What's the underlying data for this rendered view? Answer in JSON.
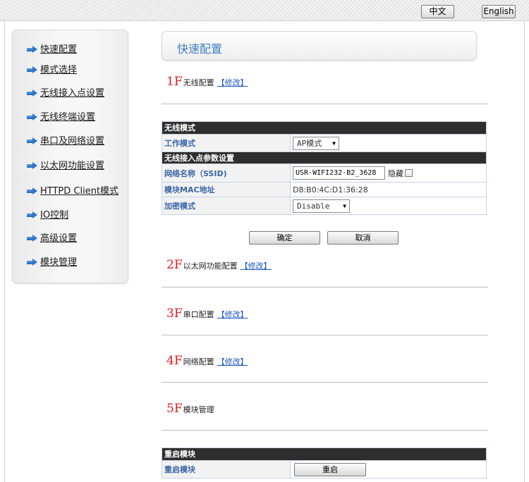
{
  "language": {
    "chinese": "中文",
    "english": "English"
  },
  "sidebar": {
    "items": [
      {
        "label": "快速配置"
      },
      {
        "label": "模式选择"
      },
      {
        "label": "无线接入点设置"
      },
      {
        "label": "无线终端设置"
      },
      {
        "label": "串口及网络设置"
      },
      {
        "label": "以太网功能设置"
      },
      {
        "label": "HTTPD Client模式"
      },
      {
        "label": "IO控制"
      },
      {
        "label": "高级设置"
      },
      {
        "label": "模块管理"
      }
    ]
  },
  "page": {
    "title": "快速配置"
  },
  "sections": {
    "wireless": {
      "num": "1F",
      "label": "无线配置",
      "link": "【修改】"
    },
    "ethernet": {
      "num": "2F",
      "label": "以太网功能配置",
      "link": "【修改】"
    },
    "serial": {
      "num": "3F",
      "label": "串口配置",
      "link": "【修改】"
    },
    "network": {
      "num": "4F",
      "label": "网络配置",
      "link": "【修改】"
    },
    "module": {
      "num": "5F",
      "label": "模块管理"
    }
  },
  "wireless_form": {
    "mode_header": "无线模式",
    "work_mode_label": "工作模式",
    "work_mode_value": "AP模式",
    "ap_header": "无线接入点参数设置",
    "ssid_label": "网络名称（SSID)",
    "ssid_value": "USR-WIFI232-B2_3628",
    "hide_label": "隐藏",
    "mac_label": "模块MAC地址",
    "mac_value": "D8:B0:4C:D1:36:28",
    "encryption_label": "加密模式",
    "encryption_value": "Disable",
    "confirm_label": "确定",
    "cancel_label": "取消"
  },
  "restart": {
    "header": "重启模块",
    "row_label": "重启模块",
    "button_label": "重启"
  }
}
